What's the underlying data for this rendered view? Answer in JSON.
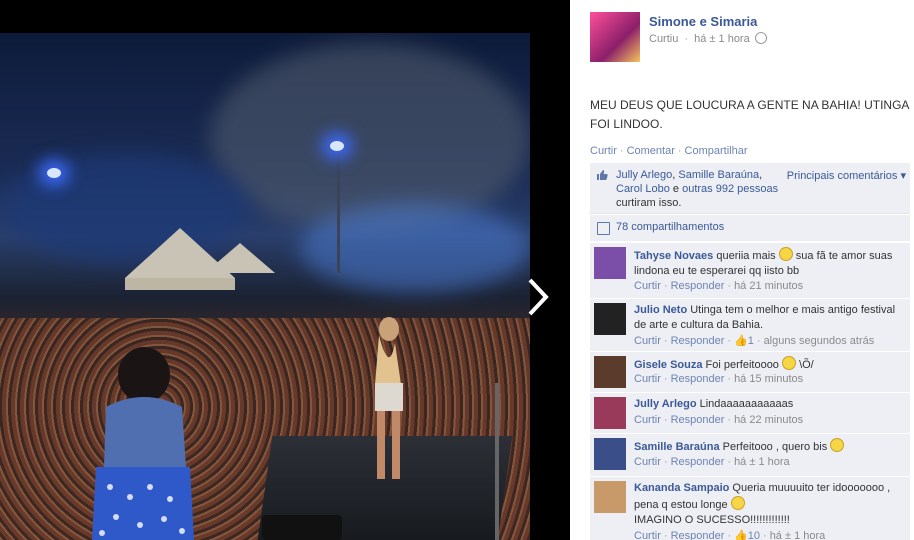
{
  "post": {
    "page_name": "Simone e Simaria",
    "meta_action": "Curtiu",
    "meta_time": "há ± 1 hora",
    "text": "MEU DEUS QUE LOUCURA A GENTE NA BAHIA! UTINGA FOI LINDOO.",
    "actions": {
      "like": "Curtir",
      "comment": "Comentar",
      "share": "Compartilhar"
    }
  },
  "likes": {
    "names": [
      "Jully Arlego",
      "Samille Baraúna",
      "Carol Lobo"
    ],
    "sep1": ", ",
    "sep2": ",",
    "and": "e",
    "others": "outras 992 pessoas",
    "suffix": "curtiram isso.",
    "sort_label": "Principais comentários"
  },
  "shares": {
    "label": "78 compartilhamentos"
  },
  "comment_actions": {
    "like": "Curtir",
    "reply": "Responder"
  },
  "comments": [
    {
      "name": "Tahyse Novaes",
      "text_a": "queriia mais",
      "text_b": "sua fã te amor suas lindona eu te esperarei qq iisto bb",
      "likes": "",
      "time": "há 21 minutos",
      "avatar_color": "#7b4fa8"
    },
    {
      "name": "Julio Neto",
      "text_a": "Utinga tem o melhor e mais antigo festival de arte e cultura da Bahia.",
      "text_b": "",
      "likes": "1",
      "time": "alguns segundos atrás",
      "avatar_color": "#222222"
    },
    {
      "name": "Gisele Souza",
      "text_a": "Foi perfeitoooo",
      "text_b": "\\Õ/",
      "likes": "",
      "time": "há 15 minutos",
      "avatar_color": "#5a3b2c"
    },
    {
      "name": "Jully Arlego",
      "text_a": "Lindaaaaaaaaaaas",
      "text_b": "",
      "likes": "",
      "time": "há 22 minutos",
      "avatar_color": "#9a3a5a"
    },
    {
      "name": "Samille Baraúna",
      "text_a": "Perfeitooo , quero bis",
      "text_b": "",
      "likes": "",
      "time": "há ± 1 hora",
      "avatar_color": "#3a4f8a"
    },
    {
      "name": "Kananda Sampaio",
      "text_a": "Queria muuuuito ter idooooooo , pena q estou longe",
      "text_b": "IMAGINO O SUCESSO!!!!!!!!!!!!!",
      "likes": "10",
      "time": "há ± 1 hora",
      "avatar_color": "#c89a6a"
    }
  ],
  "colors": {
    "link": "#3b5998",
    "ufi_bg": "#edeff4",
    "muted": "#8a8a8a"
  },
  "icons": {
    "next": "chevron-right-icon",
    "like": "thumbs-up-icon",
    "share": "share-icon",
    "privacy": "globe-icon"
  }
}
